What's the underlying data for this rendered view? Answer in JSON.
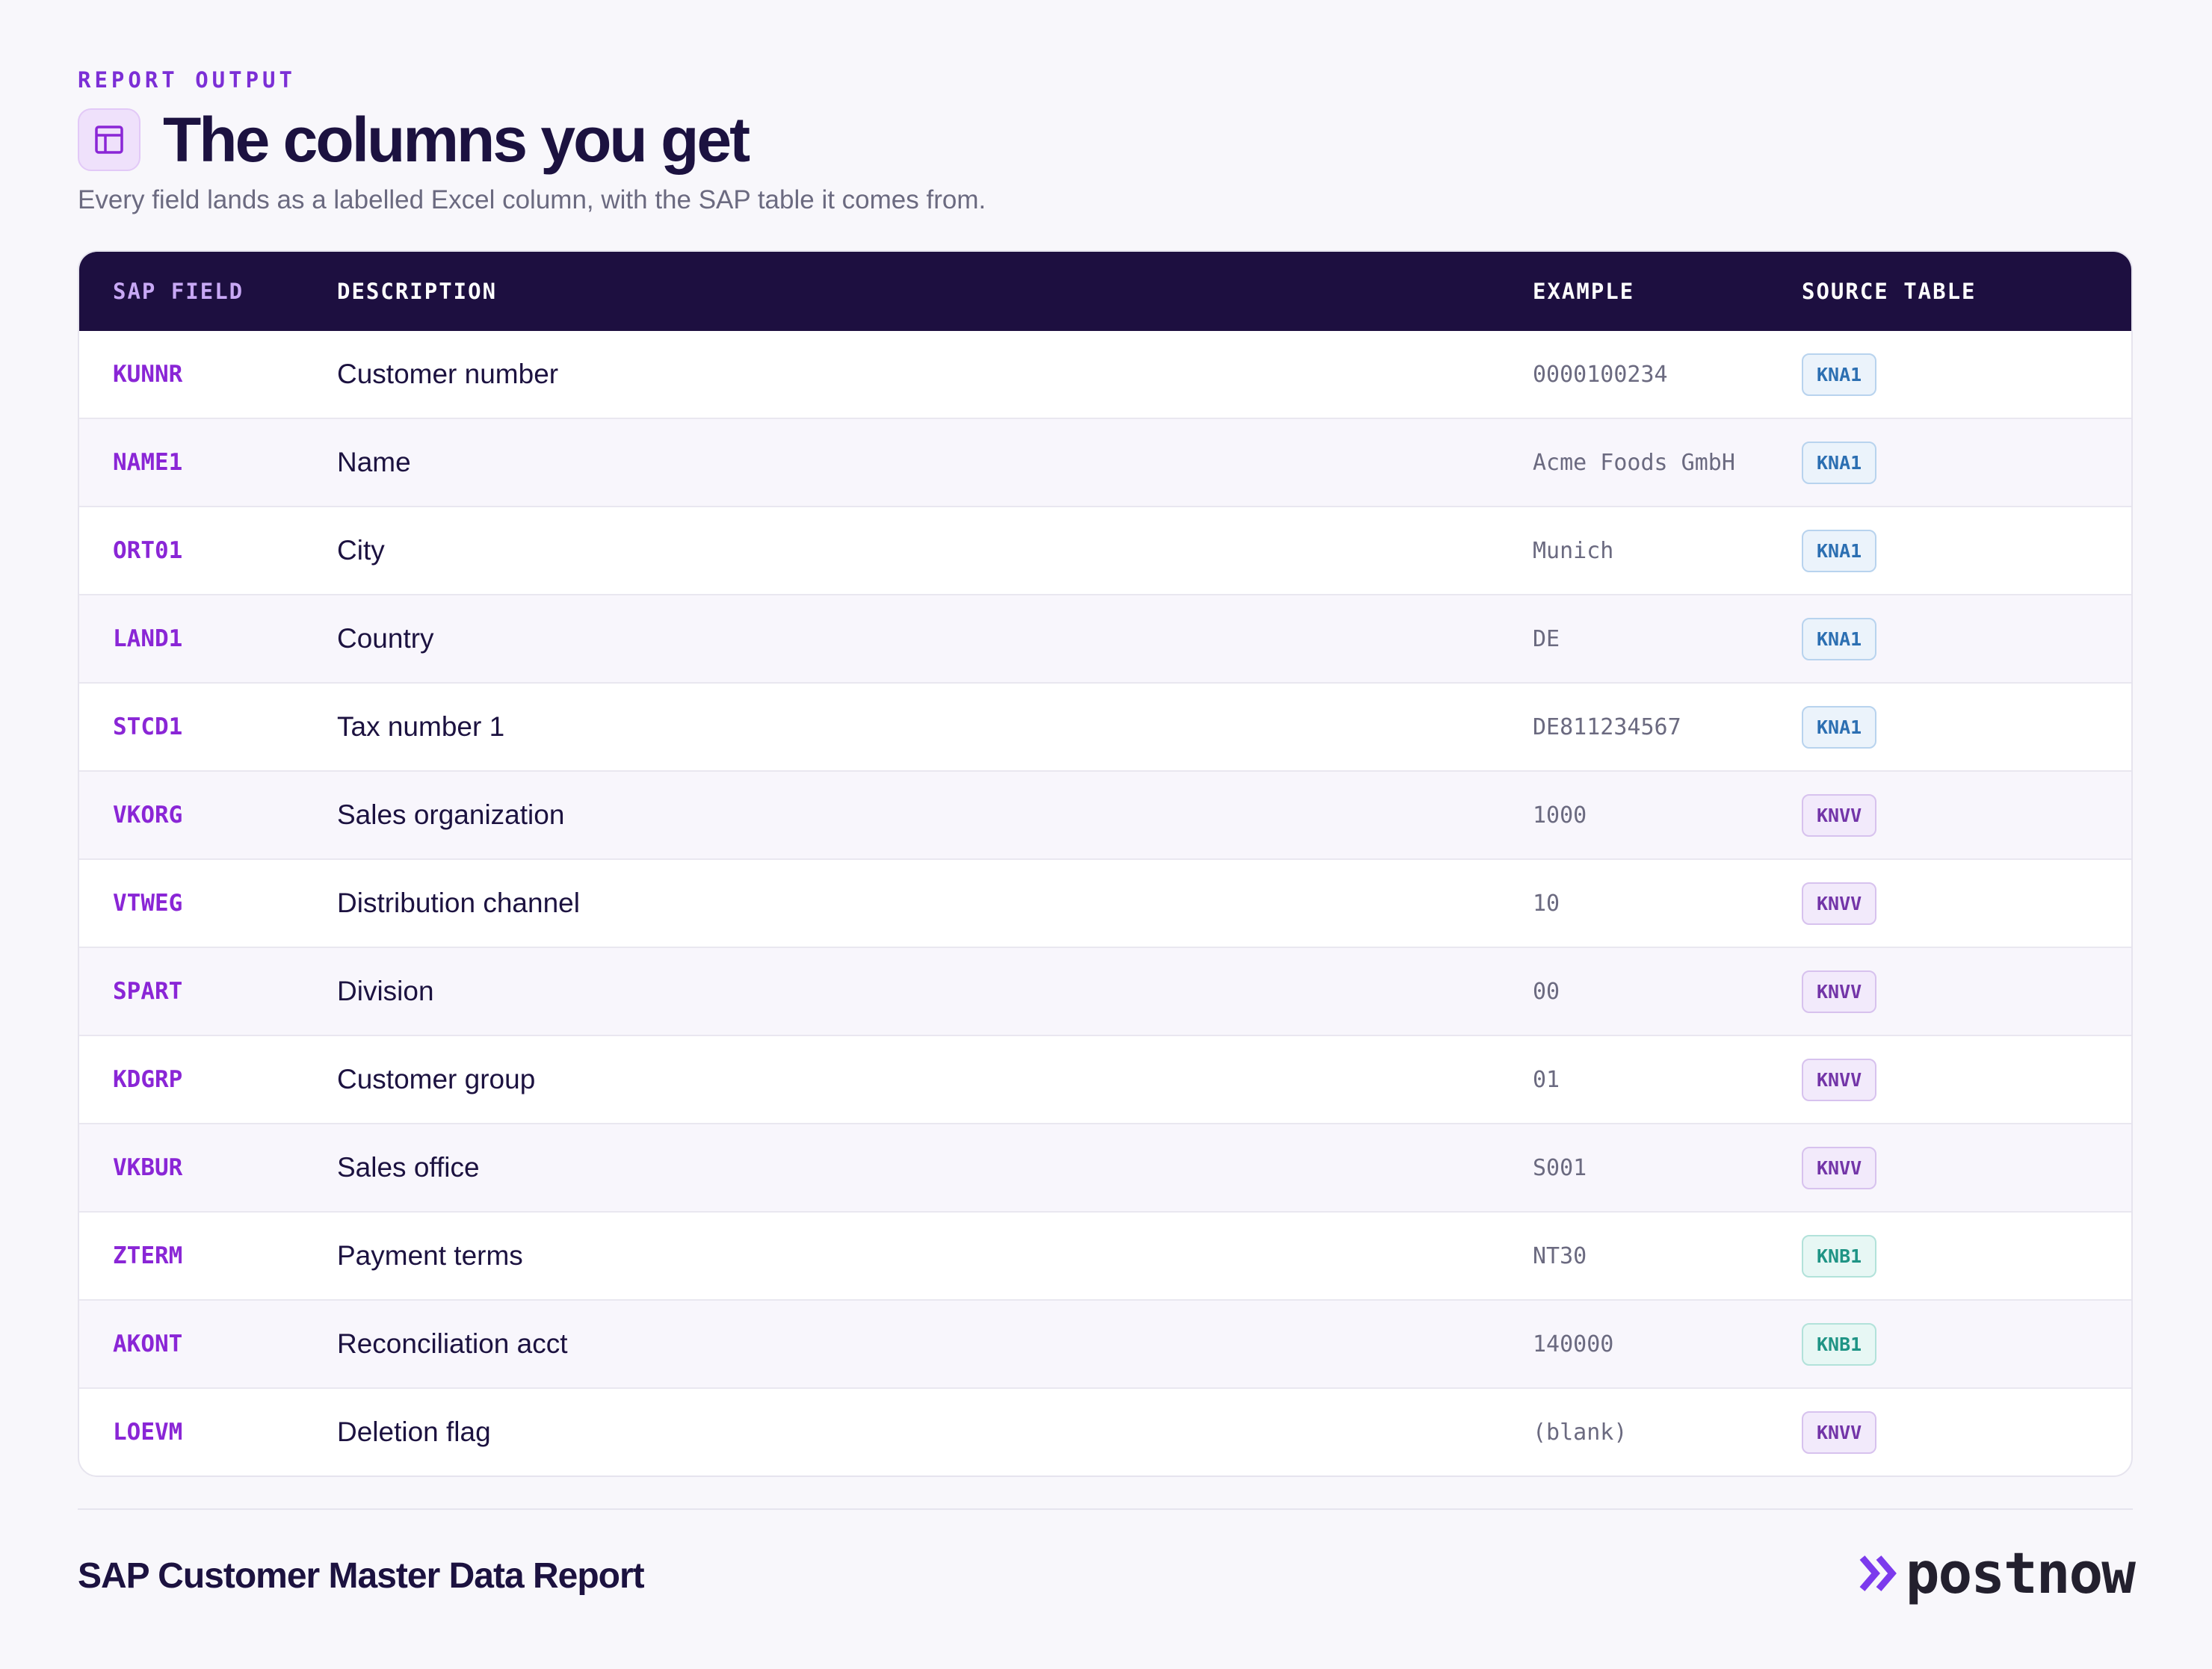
{
  "header": {
    "eyebrow": "REPORT OUTPUT",
    "title": "The columns you get",
    "subtitle": "Every field lands as a labelled Excel column, with the SAP table it comes from.",
    "icon": "table-icon"
  },
  "table": {
    "columns": {
      "field": "SAP FIELD",
      "description": "DESCRIPTION",
      "example": "EXAMPLE",
      "source": "SOURCE TABLE"
    },
    "rows": [
      {
        "field": "KUNNR",
        "description": "Customer number",
        "example": "0000100234",
        "source": "KNA1"
      },
      {
        "field": "NAME1",
        "description": "Name",
        "example": "Acme Foods GmbH",
        "source": "KNA1"
      },
      {
        "field": "ORT01",
        "description": "City",
        "example": "Munich",
        "source": "KNA1"
      },
      {
        "field": "LAND1",
        "description": "Country",
        "example": "DE",
        "source": "KNA1"
      },
      {
        "field": "STCD1",
        "description": "Tax number 1",
        "example": "DE811234567",
        "source": "KNA1"
      },
      {
        "field": "VKORG",
        "description": "Sales organization",
        "example": "1000",
        "source": "KNVV"
      },
      {
        "field": "VTWEG",
        "description": "Distribution channel",
        "example": "10",
        "source": "KNVV"
      },
      {
        "field": "SPART",
        "description": "Division",
        "example": "00",
        "source": "KNVV"
      },
      {
        "field": "KDGRP",
        "description": "Customer group",
        "example": "01",
        "source": "KNVV"
      },
      {
        "field": "VKBUR",
        "description": "Sales office",
        "example": "S001",
        "source": "KNVV"
      },
      {
        "field": "ZTERM",
        "description": "Payment terms",
        "example": "NT30",
        "source": "KNB1"
      },
      {
        "field": "AKONT",
        "description": "Reconciliation acct",
        "example": "140000",
        "source": "KNB1"
      },
      {
        "field": "LOEVM",
        "description": "Deletion flag",
        "example": "(blank)",
        "source": "KNVV"
      }
    ]
  },
  "footer": {
    "title": "SAP Customer Master Data Report",
    "logo_text": "postnow",
    "logo_icon": "double-chevron-icon"
  },
  "colors": {
    "accent": "#8a26d6",
    "header_bg": "#1d0f40",
    "kna1": "#2c6fb2",
    "knvv": "#7335a8",
    "knb1": "#1f9485"
  }
}
